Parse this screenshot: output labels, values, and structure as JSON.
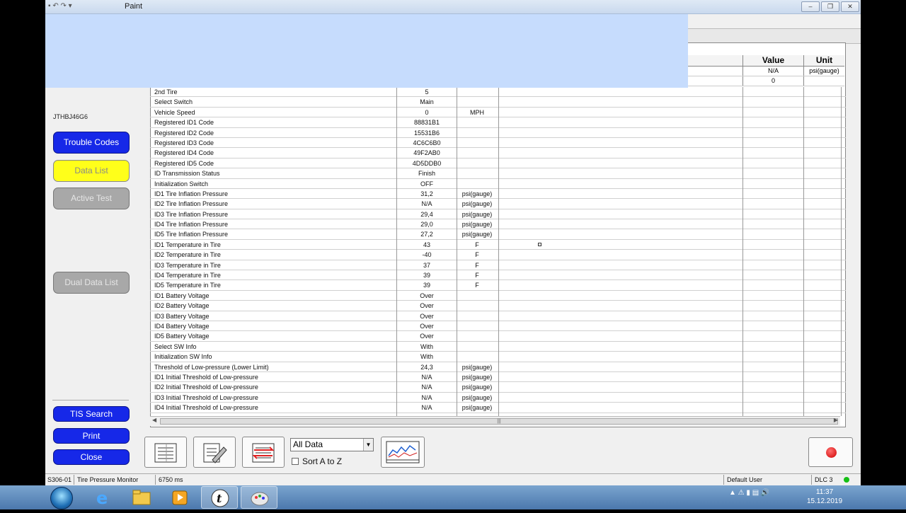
{
  "window": {
    "title": "Paint",
    "quick_access": "▪ ↶ ↷ ▾",
    "controls": [
      "–",
      "❐",
      "✕"
    ]
  },
  "left_panel": {
    "vin": "JTHBJ46G6",
    "buttons": {
      "trouble_codes": "Trouble Codes",
      "data_list": "Data List",
      "active_test": "Active Test",
      "dual_data_list": "Dual Data List",
      "tis_search": "TIS Search",
      "print": "Print",
      "close": "Close"
    }
  },
  "table": {
    "header_value": "Value",
    "header_unit": "Unit",
    "top_rows": [
      {
        "value": "N/A",
        "unit": "psi(gauge)"
      },
      {
        "value": "0",
        "unit": ""
      }
    ],
    "rows": [
      {
        "name": "2nd Tire",
        "value": "5",
        "unit": ""
      },
      {
        "name": "Select Switch",
        "value": "Main",
        "unit": ""
      },
      {
        "name": "Vehicle Speed",
        "value": "0",
        "unit": "MPH"
      },
      {
        "name": "Registered ID1 Code",
        "value": "88831B1",
        "unit": ""
      },
      {
        "name": "Registered ID2 Code",
        "value": "15531B6",
        "unit": ""
      },
      {
        "name": "Registered ID3 Code",
        "value": "4C6C6B0",
        "unit": ""
      },
      {
        "name": "Registered ID4 Code",
        "value": "49F2AB0",
        "unit": ""
      },
      {
        "name": "Registered ID5 Code",
        "value": "4D5DDB0",
        "unit": ""
      },
      {
        "name": "ID Transmission Status",
        "value": "Finish",
        "unit": ""
      },
      {
        "name": "Initialization Switch",
        "value": "OFF",
        "unit": ""
      },
      {
        "name": "ID1 Tire Inflation Pressure",
        "value": "31,2",
        "unit": "psi(gauge)"
      },
      {
        "name": "ID2 Tire Inflation Pressure",
        "value": "N/A",
        "unit": "psi(gauge)"
      },
      {
        "name": "ID3 Tire Inflation Pressure",
        "value": "29,4",
        "unit": "psi(gauge)"
      },
      {
        "name": "ID4 Tire Inflation Pressure",
        "value": "29,0",
        "unit": "psi(gauge)"
      },
      {
        "name": "ID5 Tire Inflation Pressure",
        "value": "27,2",
        "unit": "psi(gauge)"
      },
      {
        "name": "ID1 Temperature in Tire",
        "value": "43",
        "unit": "F"
      },
      {
        "name": "ID2 Temperature in Tire",
        "value": "-40",
        "unit": "F"
      },
      {
        "name": "ID3 Temperature in Tire",
        "value": "37",
        "unit": "F"
      },
      {
        "name": "ID4 Temperature in Tire",
        "value": "39",
        "unit": "F"
      },
      {
        "name": "ID5 Temperature in Tire",
        "value": "39",
        "unit": "F"
      },
      {
        "name": "ID1 Battery Voltage",
        "value": "Over",
        "unit": ""
      },
      {
        "name": "ID2 Battery Voltage",
        "value": "Over",
        "unit": ""
      },
      {
        "name": "ID3 Battery Voltage",
        "value": "Over",
        "unit": ""
      },
      {
        "name": "ID4 Battery Voltage",
        "value": "Over",
        "unit": ""
      },
      {
        "name": "ID5 Battery Voltage",
        "value": "Over",
        "unit": ""
      },
      {
        "name": "Select SW Info",
        "value": "With",
        "unit": ""
      },
      {
        "name": "Initialization SW Info",
        "value": "With",
        "unit": ""
      },
      {
        "name": "Threshold of Low-pressure (Lower Limit)",
        "value": "24,3",
        "unit": "psi(gauge)"
      },
      {
        "name": "ID1 Initial Threshold of Low-pressure",
        "value": "N/A",
        "unit": "psi(gauge)"
      },
      {
        "name": "ID2 Initial Threshold of Low-pressure",
        "value": "N/A",
        "unit": "psi(gauge)"
      },
      {
        "name": "ID3 Initial Threshold of Low-pressure",
        "value": "N/A",
        "unit": "psi(gauge)"
      },
      {
        "name": "ID4 Initial Threshold of Low-pressure",
        "value": "N/A",
        "unit": "psi(gauge)"
      }
    ]
  },
  "toolbar": {
    "filter_select": "All Data",
    "sort_label": "Sort A to Z"
  },
  "statusbar": {
    "code": "S306-01",
    "module": "Tire Pressure Monitor",
    "time": "6750 ms",
    "user": "Default User",
    "dlc": "DLC 3"
  },
  "taskbar": {
    "clock_time": "11:37",
    "clock_date": "15.12.2019"
  },
  "colors": {
    "blue_button": "#1628e8",
    "yellow_button": "#ffff1a",
    "gray_button": "#a8a8a8",
    "overlay": "#c6dcfd"
  }
}
